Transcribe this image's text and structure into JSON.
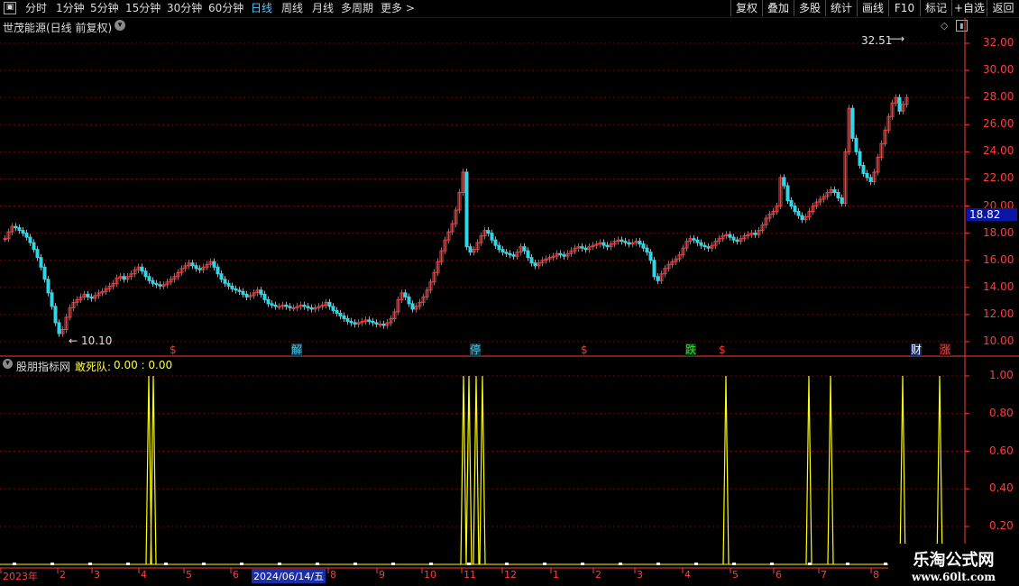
{
  "toolbar": {
    "periods": [
      "分时",
      "1分钟",
      "5分钟",
      "15分钟",
      "30分钟",
      "60分钟",
      "日线",
      "周线",
      "月线",
      "多周期",
      "更多 >"
    ],
    "active_period": "日线",
    "right_buttons": [
      "复权",
      "叠加",
      "多股",
      "统计",
      "画线",
      "F10",
      "标记",
      "+自选",
      "返回"
    ]
  },
  "main_chart": {
    "title": "世茂能源(日线 前复权)",
    "high_label": "32.51",
    "low_label": "10.10",
    "current_price": "18.82",
    "y_ticks": [
      "32.00",
      "30.00",
      "28.00",
      "26.00",
      "24.00",
      "22.00",
      "20.00",
      "18.00",
      "16.00",
      "14.00",
      "12.00",
      "10.00"
    ],
    "markers": [
      {
        "text": "$",
        "color": "#ff3030"
      },
      {
        "text": "解",
        "color": "#39c6e6"
      },
      {
        "text": "停",
        "color": "#39c6e6"
      },
      {
        "text": "$",
        "color": "#ff3030"
      },
      {
        "text": "跌",
        "color": "#33dd33"
      },
      {
        "text": "$",
        "color": "#ff3030"
      },
      {
        "text": "财",
        "color": "#ffffff"
      },
      {
        "text": "涨",
        "color": "#ff3030"
      }
    ]
  },
  "indicator": {
    "source": "股朋指标网",
    "name": "敢死队:",
    "values": "0.00 : 0.00",
    "y_ticks": [
      "1.00",
      "0.80",
      "0.60",
      "0.40",
      "0.20"
    ]
  },
  "x_axis": {
    "labels": [
      "2023年",
      "2",
      "3",
      "4",
      "5",
      "6",
      "2024/06/14/五",
      "8",
      "9",
      "10",
      "11",
      "12",
      "1",
      "2",
      "3",
      "4",
      "5",
      "6",
      "7",
      "8"
    ]
  },
  "watermark": {
    "line1": "乐淘公式网",
    "line2": "www.60lt.com"
  },
  "colors": {
    "up": "#ff3a3a",
    "down": "#31d6e6",
    "grid": "#7a0000",
    "indicator": "#ffff00",
    "axis": "#ff3c3c"
  },
  "chart_data": {
    "type": "line",
    "title": "",
    "x": [
      0,
      4,
      8,
      12,
      16,
      20,
      24,
      28,
      32,
      36,
      40,
      44,
      48,
      52,
      56,
      60,
      64,
      68,
      72,
      76,
      80,
      84,
      88,
      92,
      96,
      100,
      104,
      108,
      112,
      116,
      120,
      124,
      128,
      132,
      136,
      140,
      144,
      148,
      152,
      156,
      160,
      164,
      168,
      172,
      176,
      180,
      184,
      188,
      192,
      196,
      200,
      204,
      208,
      212,
      216,
      220,
      224,
      228,
      232,
      236,
      240,
      244,
      248,
      252,
      256,
      260,
      264,
      268,
      272,
      276,
      280,
      284,
      288,
      292,
      296,
      300,
      304,
      308,
      312,
      316,
      320,
      324,
      328,
      332,
      336,
      340,
      344,
      348,
      352,
      356,
      360,
      364,
      368,
      372,
      376,
      380,
      384,
      388,
      392,
      396,
      400,
      404,
      408,
      412,
      416,
      420,
      424,
      428,
      432,
      436,
      440,
      444,
      448,
      452,
      456,
      460,
      464,
      468,
      472,
      476,
      480,
      484,
      488,
      492,
      496,
      500,
      504,
      508,
      512,
      516,
      520,
      524,
      528,
      532,
      536,
      540,
      544,
      548,
      552,
      556,
      560,
      564,
      568,
      572,
      576,
      580,
      584,
      588,
      592,
      596,
      600,
      604,
      608,
      612,
      616,
      620,
      624,
      628,
      632,
      636,
      640,
      644,
      648,
      652,
      656,
      660,
      664,
      668,
      672,
      676,
      680,
      684,
      688,
      692,
      696,
      700,
      704,
      708,
      712,
      716,
      720,
      724,
      728,
      732,
      736,
      740,
      744,
      748,
      752,
      756,
      760,
      764,
      768,
      772,
      776,
      780,
      784,
      788,
      792,
      796,
      800,
      804,
      808,
      812,
      816,
      820,
      824,
      828,
      832,
      836,
      840,
      844,
      848,
      852,
      856,
      860,
      864,
      868,
      872,
      876,
      880,
      884,
      888,
      892,
      896,
      900,
      904,
      908,
      912,
      916,
      920,
      924,
      928,
      932,
      936,
      940,
      944,
      948,
      952,
      956,
      960,
      964,
      968,
      972,
      976,
      980,
      984,
      988,
      992,
      996,
      1000,
      1004,
      1008,
      1012,
      1016,
      1020,
      1024,
      1028,
      1032,
      1036,
      1040,
      1044,
      1048,
      1052,
      1056,
      1060,
      1064
    ],
    "series": [
      {
        "values": [
          17.6,
          18.1,
          18.5,
          18.4,
          18.2,
          18.0,
          17.7,
          17.3,
          16.8,
          16.2,
          15.5,
          14.6,
          13.6,
          12.6,
          11.4,
          10.6,
          10.9,
          11.8,
          12.5,
          12.9,
          13.1,
          13.3,
          13.5,
          13.3,
          13.2,
          13.4,
          13.6,
          13.7,
          13.9,
          14.1,
          14.3,
          14.7,
          14.8,
          14.6,
          14.8,
          15.0,
          15.3,
          15.5,
          15.2,
          14.8,
          14.5,
          14.3,
          14.2,
          14.1,
          14.2,
          14.4,
          14.6,
          14.8,
          15.1,
          15.4,
          15.6,
          15.8,
          15.6,
          15.4,
          15.3,
          15.5,
          15.7,
          15.9,
          15.5,
          15.0,
          14.6,
          14.3,
          14.1,
          13.9,
          13.8,
          13.7,
          13.5,
          13.3,
          13.4,
          13.6,
          13.8,
          13.5,
          13.1,
          12.8,
          12.7,
          12.6,
          12.6,
          12.7,
          12.6,
          12.5,
          12.5,
          12.6,
          12.7,
          12.6,
          12.5,
          12.4,
          12.5,
          12.6,
          12.7,
          12.9,
          12.6,
          12.3,
          12.1,
          11.9,
          11.7,
          11.5,
          11.4,
          11.3,
          11.4,
          11.5,
          11.6,
          11.5,
          11.4,
          11.3,
          11.3,
          11.2,
          11.4,
          11.7,
          12.2,
          13.1,
          13.6,
          13.3,
          12.8,
          12.4,
          12.6,
          12.9,
          13.3,
          13.8,
          14.4,
          15.1,
          15.9,
          16.7,
          17.5,
          18.1,
          18.7,
          19.7,
          21.0,
          22.5,
          17.0,
          16.6,
          16.8,
          17.3,
          17.8,
          18.2,
          18.0,
          17.5,
          17.1,
          16.8,
          16.6,
          16.5,
          16.4,
          16.3,
          16.6,
          17.0,
          16.7,
          16.2,
          15.8,
          15.6,
          15.8,
          16.0,
          16.1,
          16.2,
          16.3,
          16.5,
          16.4,
          16.3,
          16.5,
          16.7,
          16.9,
          17.0,
          16.9,
          16.8,
          17.0,
          17.1,
          17.2,
          17.3,
          17.1,
          17.0,
          17.2,
          17.4,
          17.5,
          17.4,
          17.3,
          17.2,
          17.3,
          17.4,
          17.2,
          16.9,
          16.6,
          16.0,
          14.8,
          14.5,
          15.0,
          15.4,
          15.7,
          15.9,
          16.1,
          16.4,
          16.9,
          17.4,
          17.6,
          17.5,
          17.3,
          17.1,
          17.0,
          16.9,
          17.1,
          17.4,
          17.6,
          17.8,
          17.9,
          17.7,
          17.5,
          17.4,
          17.6,
          17.8,
          17.9,
          18.0,
          17.9,
          18.2,
          18.6,
          19.1,
          19.4,
          19.6,
          20.0,
          22.1,
          21.5,
          20.4,
          20.0,
          19.6,
          19.3,
          19.0,
          19.2,
          19.6,
          20.0,
          20.3,
          20.5,
          20.7,
          21.0,
          21.2,
          21.0,
          20.6,
          20.2,
          24.0,
          27.2,
          25.0,
          24.0,
          23.0,
          22.4,
          22.1,
          21.8,
          22.5,
          23.6,
          24.6,
          25.6,
          26.6,
          27.6,
          28.0,
          27.0,
          27.5,
          28.0
        ]
      }
    ],
    "ylim": [
      9.2,
      33.2
    ]
  }
}
